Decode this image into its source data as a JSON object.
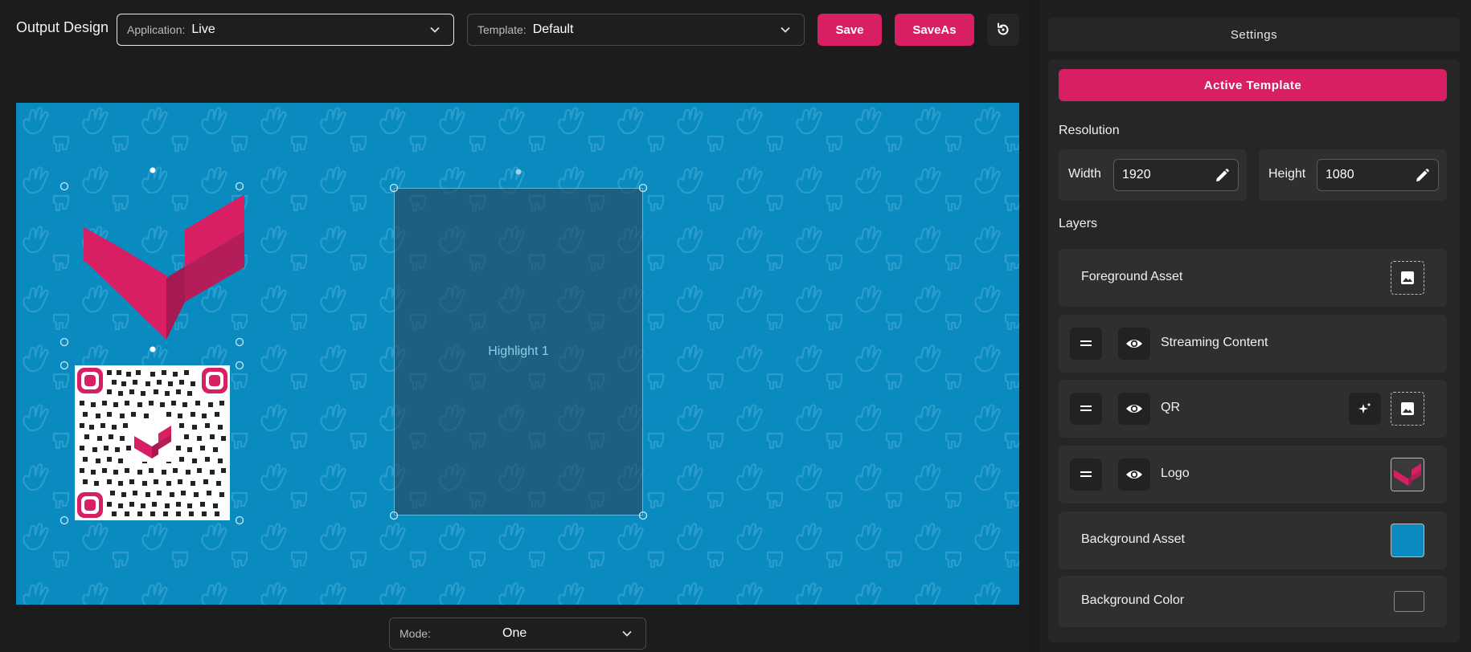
{
  "header": {
    "title": "Output Design",
    "application": {
      "label": "Application:",
      "value": "Live"
    },
    "template": {
      "label": "Template:",
      "value": "Default"
    },
    "save_label": "Save",
    "save_as_label": "SaveAs"
  },
  "canvas": {
    "background_color": "#0a8bc0",
    "highlight_label": "Highlight 1"
  },
  "mode": {
    "label": "Mode:",
    "value": "One"
  },
  "settings": {
    "title": "Settings",
    "active_template_label": "Active Template",
    "resolution": {
      "title": "Resolution",
      "width_label": "Width",
      "width_value": "1920",
      "height_label": "Height",
      "height_value": "1080"
    },
    "layers_title": "Layers",
    "layers": [
      {
        "name": "Foreground Asset"
      },
      {
        "name": "Streaming Content"
      },
      {
        "name": "QR"
      },
      {
        "name": "Logo"
      },
      {
        "name": "Background Asset"
      },
      {
        "name": "Background Color"
      }
    ]
  },
  "colors": {
    "accent": "#d81f63",
    "panel": "#262626",
    "background": "#1a1a1a"
  }
}
